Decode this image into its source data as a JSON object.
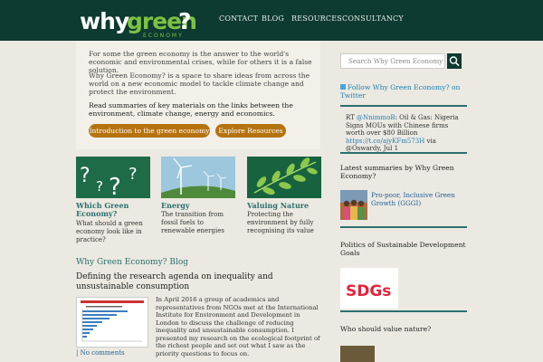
{
  "logo": {
    "why": "why",
    "green": "green",
    "q": "?",
    "tagline": "ECONOMY"
  },
  "nav": [
    "CONTACT",
    "BLOG",
    "RESOURCES",
    "CONSULTANCY"
  ],
  "hero": {
    "p1": "For some the green economy is the answer to the world's economic and environmental crises, while for others it is a false solution.",
    "p2": "Why Green Economy? is a space to share ideas from across the world on a new economic model to tackle climate change and protect the environment.",
    "p3": "Read summaries of key materials on the links between the environment, climate change, energy and economics.",
    "btn1": "Introduction to the green economy",
    "btn2": "Explore Resources"
  },
  "categories": [
    {
      "title": "Which Green Economy?",
      "desc": "What should a green economy look like in practice?"
    },
    {
      "title": "Energy",
      "desc": "The transition from fossil fuels to renewable energies"
    },
    {
      "title": "Valuing Nature",
      "desc": "Protecting the environment by fully recognising its value"
    }
  ],
  "blog": {
    "heading": "Why Green Economy? Blog",
    "post_title": "Defining the research agenda on inequality and unsustainable consumption",
    "post_text": "In April 2016 a group of academics and representatives from NGOs met at the International Institute for Environment and Development in London to discuss the challenge of reducing inequality and unsustainable consumption. I presented my research on the ecological footprint of the richest people and set out what I saw as the priority questions to focus on.",
    "comments": "| No comments"
  },
  "sidebar": {
    "search_placeholder": "Search Why Green Economy",
    "twitter_link": "Follow Why Green Economy? on Twitter",
    "tweet_rt": "RT ",
    "tweet_user": "@NnimmoB",
    "tweet_body": ": Oil & Gas: Nigeria Signs MOUs with Chinese firms worth over $80 Billion ",
    "tweet_url": "https://t.co/ajyKFm573H",
    "tweet_end": " via @Oswardy, Jul 1",
    "summaries_heading": "Latest summaries by Why Green Economy?",
    "summary_link": "Pro-poor, Inclusive Green Growth (GGGI)",
    "politics_heading": "Politics of Sustainable Development Goals",
    "sdg_text": "SDGs",
    "nature_heading": "Who should value nature?"
  },
  "colors": {
    "header": "#0d3a31",
    "accent_green": "#7cc242",
    "button": "#b5730f",
    "link": "#1f5f99",
    "teal": "#2b6f6e"
  }
}
